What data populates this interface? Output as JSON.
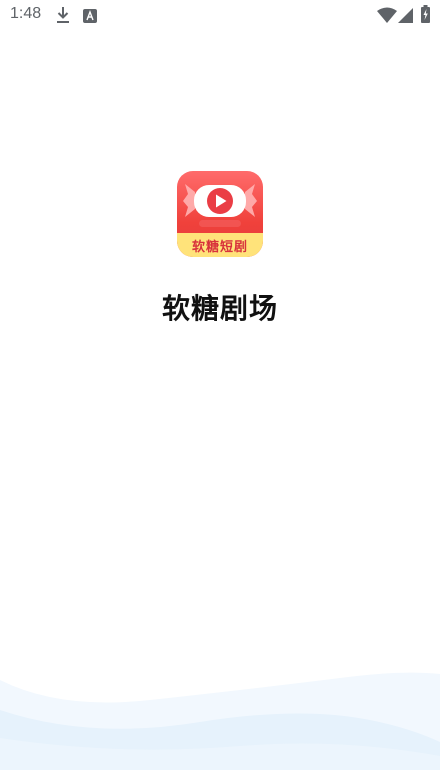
{
  "status_bar": {
    "time": "1:48",
    "icons": [
      "download-icon",
      "font-badge-icon",
      "wifi-icon",
      "signal-icon",
      "battery-charging-icon"
    ]
  },
  "splash": {
    "logo_banner_text": "软糖短剧",
    "app_name": "软糖剧场"
  },
  "colors": {
    "logo_red": "#f0413b",
    "logo_banner_yellow": "#ffe37a",
    "wave_blue": "#e6f2fc"
  }
}
